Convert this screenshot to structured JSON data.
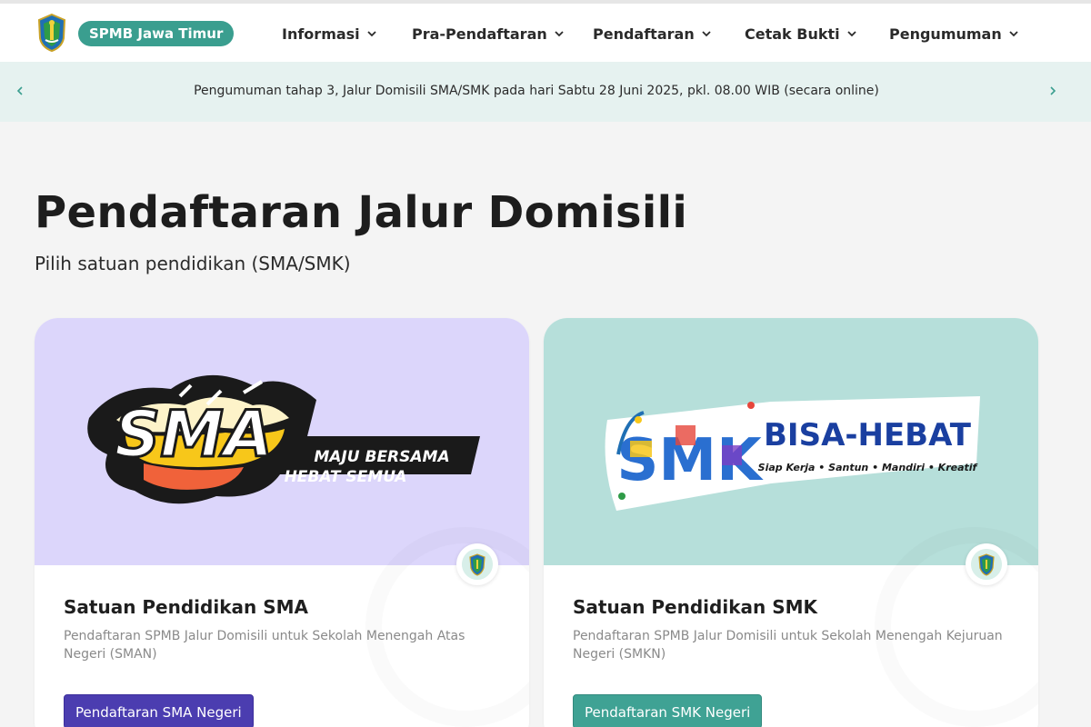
{
  "header": {
    "brand": "SPMB Jawa Timur",
    "nav": [
      {
        "label": "Informasi"
      },
      {
        "label": "Pra-Pendaftaran"
      },
      {
        "label": "Pendaftaran"
      },
      {
        "label": "Cetak Bukti"
      },
      {
        "label": "Pengumuman"
      }
    ]
  },
  "announcement": {
    "text": "Pengumuman tahap 3, Jalur Domisili SMA/SMK pada hari Sabtu 28 Juni 2025, pkl. 08.00 WIB (secara online)"
  },
  "page": {
    "title": "Pendaftaran Jalur Domisili",
    "subtitle": "Pilih satuan pendidikan (SMA/SMK)"
  },
  "cards": [
    {
      "logo_main": "SMA",
      "logo_line1": "MAJU BERSAMA",
      "logo_line2": "HEBAT SEMUA",
      "title": "Satuan Pendidikan SMA",
      "description": "Pendaftaran SPMB Jalur Domisili untuk Sekolah Menengah Atas Negeri (SMAN)",
      "button": "Pendaftaran SMA Negeri"
    },
    {
      "logo_main": "SMK",
      "logo_line1": "BISA-HEBAT",
      "logo_line2": "Siap Kerja • Santun • Mandiri • Kreatif",
      "title": "Satuan Pendidikan SMK",
      "description": "Pendaftaran SPMB Jalur Domisili untuk Sekolah Menengah Kejuruan Negeri (SMKN)",
      "button": "Pendaftaran SMK Negeri"
    }
  ],
  "colors": {
    "brand_teal": "#3a9e8f",
    "sma_purple": "#4b3db0",
    "smk_teal": "#3fa294",
    "sma_banner": "#dcd6fb",
    "smk_banner": "#b6dfda",
    "announce_bg": "#e6f2f0"
  },
  "icons": {
    "logo": "jawa-timur-emblem-icon",
    "nav_chevron": "chevron-down-icon",
    "announce_prev": "chevron-left-icon",
    "announce_next": "chevron-right-icon",
    "card_badge": "jawa-timur-emblem-icon"
  }
}
